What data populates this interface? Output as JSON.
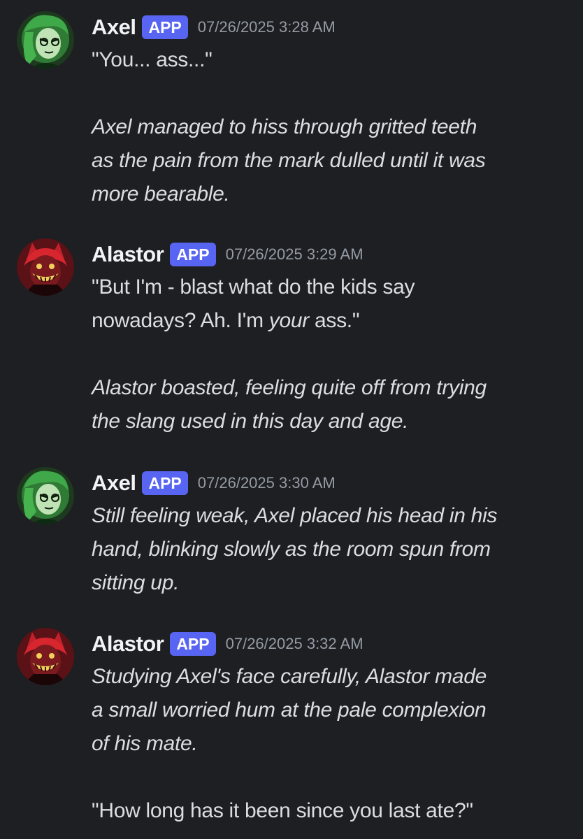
{
  "messages": [
    {
      "author": "Axel",
      "badge": "APP",
      "timestamp": "07/26/2025 3:28 AM",
      "avatar_icon": "axel-avatar",
      "paragraphs": [
        "\"You... ass...\"",
        "Axel managed to hiss through gritted teeth\nas the pain from the mark dulled until it was\nmore bearable."
      ]
    },
    {
      "author": "Alastor",
      "badge": "APP",
      "timestamp": "07/26/2025 3:29 AM",
      "avatar_icon": "alastor-avatar",
      "line1": "\"But I'm - blast what do the kids say",
      "line2_before": "nowadays? Ah. I'm ",
      "line2_emph": "your",
      "line2_after": " ass.\"",
      "paragraph2": "Alastor boasted, feeling quite off from trying\nthe slang used in this day and age."
    },
    {
      "author": "Axel",
      "badge": "APP",
      "timestamp": "07/26/2025 3:30 AM",
      "avatar_icon": "axel-avatar",
      "paragraphs": [
        "Still feeling weak, Axel placed his head in his\nhand, blinking slowly as the room spun from\nsitting up."
      ]
    },
    {
      "author": "Alastor",
      "badge": "APP",
      "timestamp": "07/26/2025 3:32 AM",
      "avatar_icon": "alastor-avatar",
      "paragraphs": [
        "Studying Axel's face carefully, Alastor made\na small worried hum at the pale complexion\nof his mate.",
        "\"How long has it been since you last ate?\""
      ]
    }
  ],
  "colors": {
    "background": "#1e1f22",
    "username": "#f2f3f5",
    "badge": "#5865f2",
    "timestamp": "#949ba4",
    "text": "#dbdee1"
  }
}
